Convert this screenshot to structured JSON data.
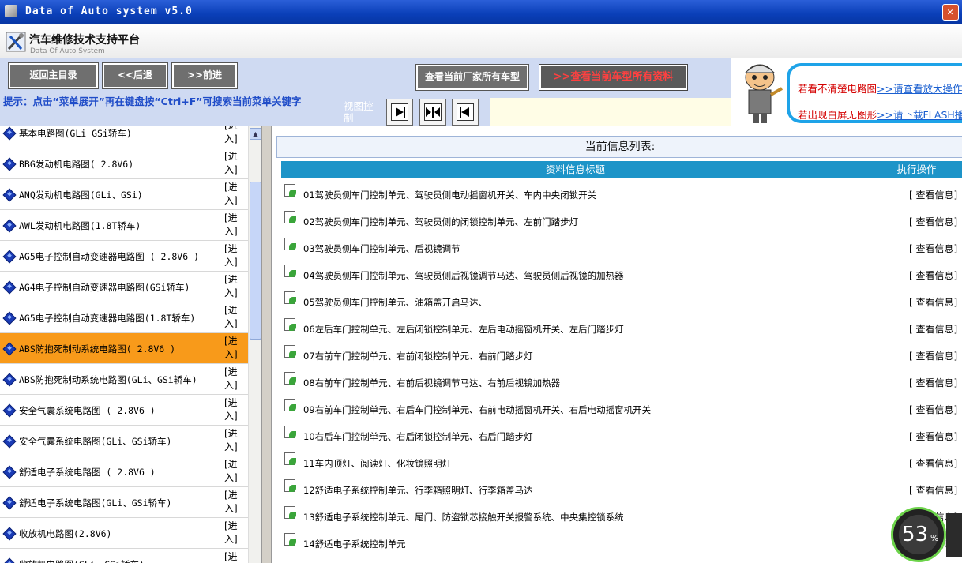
{
  "window": {
    "title": "Data of Auto system v5.0"
  },
  "header": {
    "title": "汽车维修技术支持平台",
    "subtitle": "Data Of Auto System"
  },
  "toolbar": {
    "home_label": "返回主目录",
    "back_label": "<<后退",
    "forward_label": ">>前进",
    "all_models_label": "查看当前厂家所有车型",
    "all_data_label": ">>查看当前车型所有资料",
    "tip": "提示：点击“菜单展开”再在键盘按“Ctrl+F”可搜索当前菜单关键字",
    "view_label": "视图控制"
  },
  "info": {
    "line1_text": "若看不清楚电路图",
    "line1_link": ">>请查看放大操作",
    "line2_text": "若出现白屏无图形",
    "line2_link": ">>请下载FLASH播"
  },
  "left": {
    "enter_label": "[进入]",
    "items": [
      {
        "label": "基本电路图(GLi GSi轿车)"
      },
      {
        "label": "BBG发动机电路图( 2.8V6)"
      },
      {
        "label": "ANQ发动机电路图(GLi、GSi)"
      },
      {
        "label": "AWL发动机电路图(1.8T轿车)"
      },
      {
        "label": "AG5电子控制自动变速器电路图 ( 2.8V6 )"
      },
      {
        "label": "AG4电子控制自动变速器电路图(GSi轿车)"
      },
      {
        "label": "AG5电子控制自动变速器电路图(1.8T轿车)"
      },
      {
        "label": "ABS防抱死制动系统电路图( 2.8V6 )",
        "selected": true
      },
      {
        "label": "ABS防抱死制动系统电路图(GLi、GSi轿车)"
      },
      {
        "label": "安全气囊系统电路图 ( 2.8V6 )"
      },
      {
        "label": "安全气囊系统电路图(GLi、GSi轿车)"
      },
      {
        "label": "舒适电子系统电路图 ( 2.8V6 )"
      },
      {
        "label": "舒适电子系统电路图(GLi、GSi轿车)"
      },
      {
        "label": "收放机电路图(2.8V6)"
      },
      {
        "label": "收放机电路图(GLi、GSi轿车)"
      }
    ]
  },
  "main": {
    "header": "当前信息列表:",
    "col_title": "资料信息标题",
    "col_action": "执行操作",
    "action_label": "[ 查看信息]",
    "rows": [
      "01驾驶员侧车门控制单元、驾驶员侧电动摇窗机开关、车内中央闭锁开关",
      "02驾驶员侧车门控制单元、驾驶员侧的闭锁控制单元、左前门踏步灯",
      "03驾驶员侧车门控制单元、后视镜调节",
      "04驾驶员侧车门控制单元、驾驶员侧后视镜调节马达、驾驶员侧后视镜的加热器",
      "05驾驶员侧车门控制单元、油箱盖开启马达、",
      "06左后车门控制单元、左后闭锁控制单元、左后电动摇窗机开关、左后门踏步灯",
      "07右前车门控制单元、右前闭锁控制单元、右前门踏步灯",
      "08右前车门控制单元、右前后视镜调节马达、右前后视镜加热器",
      "09右前车门控制单元、右后车门控制单元、右前电动摇窗机开关、右后电动摇窗机开关",
      "10右后车门控制单元、右后闭锁控制单元、右后门踏步灯",
      "11车内顶灯、阅读灯、化妆镜照明灯",
      "12舒适电子系统控制单元、行李箱照明灯、行李箱盖马达",
      "13舒适电子系统控制单元、尾门、防盗锁芯接触开关报警系统、中央集控锁系统",
      "14舒适电子系统控制单元"
    ]
  },
  "gauge": {
    "value": "53",
    "unit": "%"
  },
  "colors": {
    "selected_row": "#f89a1a",
    "column_header": "#1d94c8",
    "tip_text": "#1f4cc8"
  }
}
